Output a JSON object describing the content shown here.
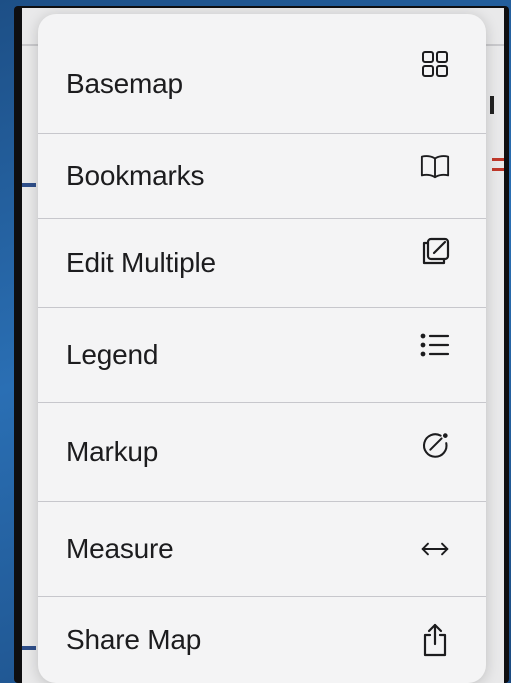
{
  "menu": {
    "items": [
      {
        "label": "Basemap",
        "icon": "grid-icon"
      },
      {
        "label": "Bookmarks",
        "icon": "book-icon"
      },
      {
        "label": "Edit Multiple",
        "icon": "edit-icon"
      },
      {
        "label": "Legend",
        "icon": "list-icon"
      },
      {
        "label": "Markup",
        "icon": "markup-icon"
      },
      {
        "label": "Measure",
        "icon": "measure-icon"
      },
      {
        "label": "Share Map",
        "icon": "share-icon"
      }
    ]
  },
  "colors": {
    "menu_background": "#f4f4f5",
    "text": "#1c1c1e",
    "divider": "#c7c7cc",
    "backdrop": "#2a6fb4"
  }
}
